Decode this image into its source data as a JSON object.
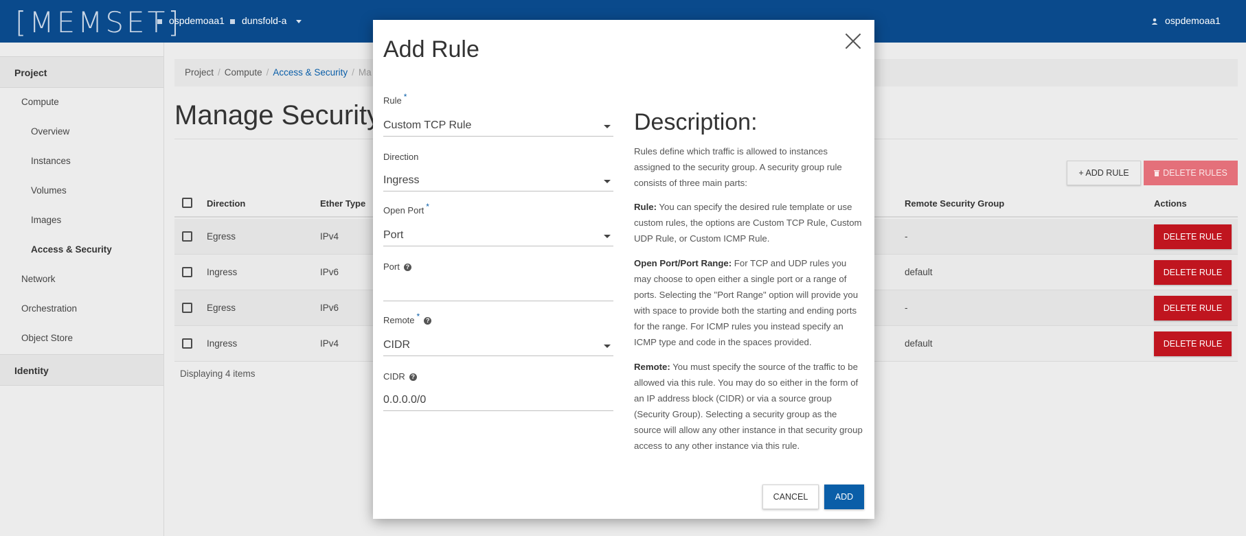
{
  "topbar": {
    "logo": "[MEMSET]",
    "project": "ospdemoaa1",
    "region": "dunsfold-a",
    "user": "ospdemoaa1"
  },
  "sidebar": {
    "project": "Project",
    "compute": "Compute",
    "overview": "Overview",
    "instances": "Instances",
    "volumes": "Volumes",
    "images": "Images",
    "access_security": "Access & Security",
    "network": "Network",
    "orchestration": "Orchestration",
    "object_store": "Object Store",
    "identity": "Identity"
  },
  "breadcrumb": {
    "project": "Project",
    "compute": "Compute",
    "access_security": "Access & Security",
    "current": "Ma"
  },
  "page": {
    "title": "Manage Security",
    "add_rule": "+ ADD RULE",
    "delete_rules": "DELETE RULES",
    "displaying": "Displaying 4 items"
  },
  "table": {
    "headers": {
      "direction": "Direction",
      "ether_type": "Ether Type",
      "remote_group": "Remote Security Group",
      "actions": "Actions"
    },
    "rows": [
      {
        "direction": "Egress",
        "ether": "IPv4",
        "remote": "-",
        "action": "DELETE RULE"
      },
      {
        "direction": "Ingress",
        "ether": "IPv6",
        "remote": "default",
        "action": "DELETE RULE"
      },
      {
        "direction": "Egress",
        "ether": "IPv6",
        "remote": "-",
        "action": "DELETE RULE"
      },
      {
        "direction": "Ingress",
        "ether": "IPv4",
        "remote": "default",
        "action": "DELETE RULE"
      }
    ]
  },
  "modal": {
    "title": "Add Rule",
    "rule_label": "Rule",
    "rule_value": "Custom TCP Rule",
    "direction_label": "Direction",
    "direction_value": "Ingress",
    "open_port_label": "Open Port",
    "open_port_value": "Port",
    "port_label": "Port",
    "port_value": "",
    "remote_label": "Remote",
    "remote_value": "CIDR",
    "cidr_label": "CIDR",
    "cidr_value": "0.0.0.0/0",
    "desc_title": "Description:",
    "desc_intro": "Rules define which traffic is allowed to instances assigned to the security group. A security group rule consists of three main parts:",
    "desc_rule_b": "Rule:",
    "desc_rule": " You can specify the desired rule template or use custom rules, the options are Custom TCP Rule, Custom UDP Rule, or Custom ICMP Rule.",
    "desc_port_b": "Open Port/Port Range:",
    "desc_port": " For TCP and UDP rules you may choose to open either a single port or a range of ports. Selecting the \"Port Range\" option will provide you with space to provide both the starting and ending ports for the range. For ICMP rules you instead specify an ICMP type and code in the spaces provided.",
    "desc_remote_b": "Remote:",
    "desc_remote": " You must specify the source of the traffic to be allowed via this rule. You may do so either in the form of an IP address block (CIDR) or via a source group (Security Group). Selecting a security group as the source will allow any other instance in that security group access to any other instance via this rule.",
    "cancel": "CANCEL",
    "add": "ADD"
  },
  "colors": {
    "brand": "#0a4a8c",
    "primary": "#0a5ea8",
    "danger": "#c0151f"
  }
}
